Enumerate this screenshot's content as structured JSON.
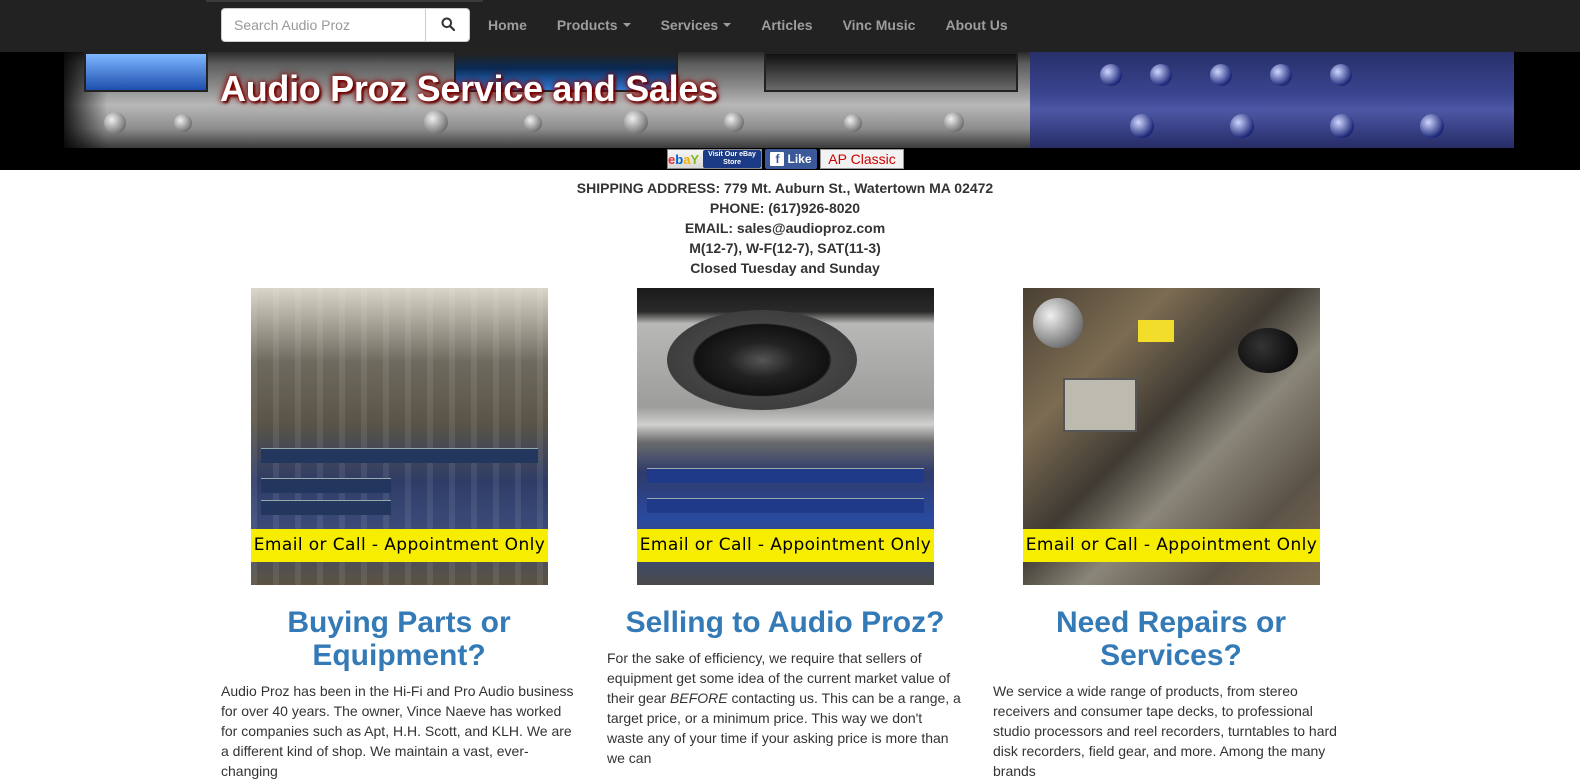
{
  "navbar": {
    "search_placeholder": "Search Audio Proz",
    "items": [
      {
        "label": "Home"
      },
      {
        "label": "Products",
        "dropdown": true
      },
      {
        "label": "Services",
        "dropdown": true
      },
      {
        "label": "Articles"
      },
      {
        "label": "Vinc Music"
      },
      {
        "label": "About Us"
      }
    ]
  },
  "banner": {
    "title": "Audio Proz Service and Sales",
    "badges": {
      "ebay_text": "Visit Our eBay Store",
      "facebook_text": "Like",
      "ap_classic_text": "AP Classic"
    }
  },
  "contact": {
    "address": "SHIPPING ADDRESS: 779 Mt. Auburn St., Watertown MA 02472",
    "phone": "PHONE: (617)926-8020",
    "email": "EMAIL: sales@audioproz.com",
    "hours": "M(12-7), W-F(12-7), SAT(11-3)",
    "closed": "Closed Tuesday and Sunday"
  },
  "cards": [
    {
      "banner": "Email or Call - Appointment Only",
      "title": "Buying Parts or Equipment?",
      "text": "Audio Proz has been in the Hi-Fi and Pro Audio business for over 40 years. The owner, Vince Naeve has worked for companies such as Apt, H.H. Scott, and KLH. We are a different kind of shop. We maintain a vast, ever-changing"
    },
    {
      "banner": "Email or Call - Appointment Only",
      "title": "Selling to Audio Proz?",
      "text_before": "For the sake of efficiency, we require that sellers of equipment get some idea of the current market value of their gear ",
      "text_emphasis": "BEFORE",
      "text_after": " contacting us. This can be a range, a target price, or a minimum price. This way we don't waste any of your time if your asking price is more than we can"
    },
    {
      "banner": "Email or Call - Appointment Only",
      "title": "Need Repairs or Services?",
      "text": "We service a wide range of products, from stereo receivers and consumer tape decks, to professional studio processors and reel recorders, turntables to hard disk recorders, field gear, and more. Among the many brands"
    }
  ],
  "colors": {
    "navbar_bg": "#222222",
    "nav_text": "#9d9d9d",
    "title_blue": "#337ab7",
    "appointment_yellow": "#f7ed00"
  }
}
